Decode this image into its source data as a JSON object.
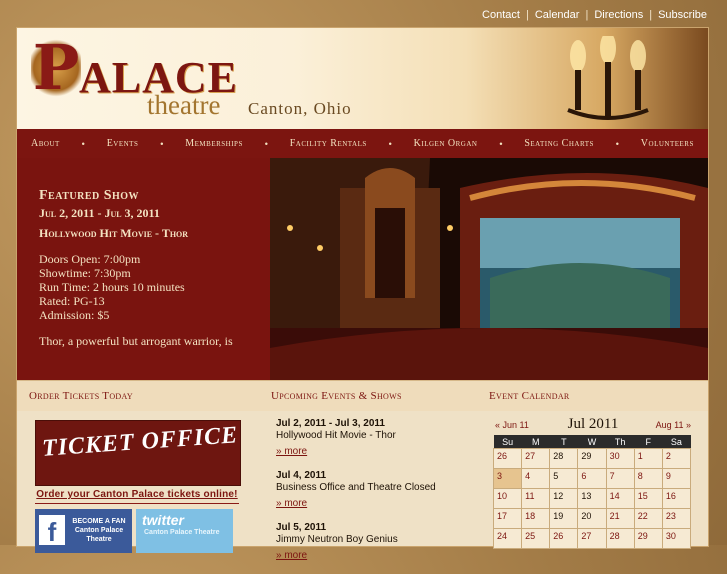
{
  "top_links": [
    "Contact",
    "Calendar",
    "Directions",
    "Subscribe"
  ],
  "logo": {
    "word": "ALACE",
    "initial": "P",
    "theatre": "theatre",
    "city": "Canton, Ohio"
  },
  "nav": {
    "items": [
      "About",
      "Events",
      "Memberships",
      "Facility Rentals",
      "Kilgen Organ",
      "Seating Charts",
      "Volunteers"
    ]
  },
  "featured": {
    "heading": "Featured Show",
    "dates": "Jul 2, 2011 - Jul 3, 2011",
    "movie": "Hollywood Hit Movie - Thor",
    "doors": "Doors Open: 7:00pm",
    "showtime": "Showtime: 7:30pm",
    "runtime": "Run Time: 2 hours 10 minutes",
    "rated": "Rated: PG-13",
    "admission": "Admission: $5",
    "description": "Thor, a powerful but arrogant warrior, is"
  },
  "sections": {
    "order": "Order Tickets Today",
    "upcoming": "Upcoming Events & Shows",
    "calendar": "Event Calendar"
  },
  "tickets": {
    "sign": "TICKET OFFICE",
    "link": "Order your Canton Palace tickets online!"
  },
  "social": {
    "facebook_line1": "BECOME A FAN",
    "facebook_line2": "Canton Palace",
    "facebook_line3": "Theatre",
    "twitter_logo": "twitter",
    "twitter_line": "Canton Palace Theatre"
  },
  "events": [
    {
      "date": "Jul 2, 2011 - Jul 3, 2011",
      "name": "Hollywood Hit Movie - Thor",
      "more": "» more"
    },
    {
      "date": "Jul 4, 2011",
      "name": "Business Office and Theatre Closed",
      "more": "» more"
    },
    {
      "date": "Jul 5, 2011",
      "name": "Jimmy Neutron Boy Genius",
      "more": "» more"
    }
  ],
  "calendar": {
    "prev": "« Jun 11",
    "month": "Jul 2011",
    "next": "Aug 11 »",
    "days": [
      "Su",
      "M",
      "T",
      "W",
      "Th",
      "F",
      "Sa"
    ],
    "weeks": [
      [
        "26",
        "27",
        "28",
        "29",
        "30",
        "1",
        "2"
      ],
      [
        "3",
        "4",
        "5",
        "6",
        "7",
        "8",
        "9"
      ],
      [
        "10",
        "11",
        "12",
        "13",
        "14",
        "15",
        "16"
      ],
      [
        "17",
        "18",
        "19",
        "20",
        "21",
        "22",
        "23"
      ],
      [
        "24",
        "25",
        "26",
        "27",
        "28",
        "29",
        "30"
      ]
    ]
  },
  "colors": {
    "brand_red": "#7c1510",
    "background_tan": "#b08a55",
    "panel_cream": "#efe1c6"
  }
}
